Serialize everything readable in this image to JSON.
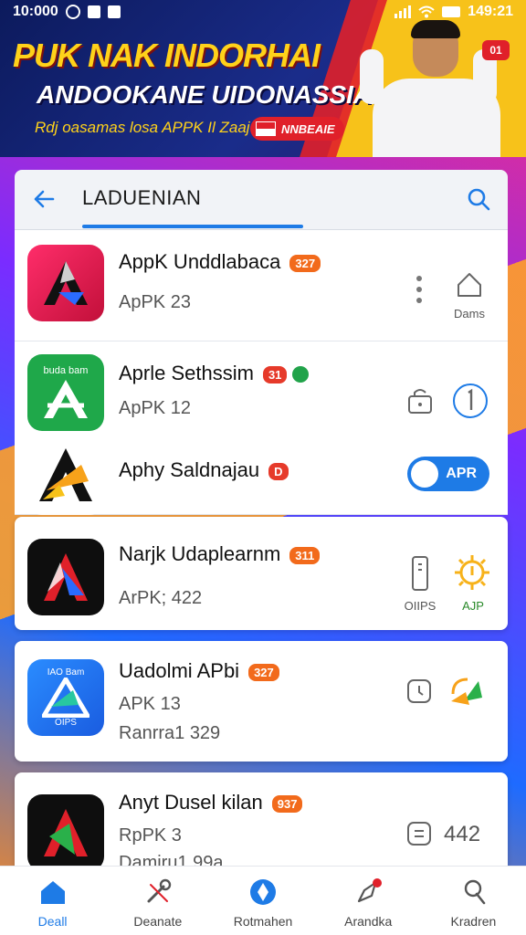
{
  "status_bar": {
    "time": "10:000",
    "right": "149:21"
  },
  "banner": {
    "title": "PUK NAK INDORHAI",
    "subtitle": "ANDOOKANE UIDONASSIAI",
    "tagline": "Rdj oasamas losa APPK Il Zaaj",
    "button": "NNBEAIE",
    "badge": "01"
  },
  "search": {
    "title": "LADUENIAN"
  },
  "apps": [
    {
      "name": "AppK Unddlabaca",
      "badge": "327",
      "meta": "ApPK 23",
      "side_label": "Dams"
    },
    {
      "name": "Aprle Sethssim",
      "badge": "31",
      "meta": "ApPK 12"
    },
    {
      "name": "Aphy Saldnajau",
      "badge": "D",
      "install_label": "APR"
    },
    {
      "name": "Narjk Udaplearnm",
      "badge": "311",
      "meta": "ArPK; 422",
      "side_label_1": "OIIPS",
      "side_label_2": "AJP"
    },
    {
      "name": "Uadolmi APbi",
      "badge": "327",
      "meta": "APK 13",
      "meta2": "Ranrra1 329",
      "icon_text_top": "IAO Bam",
      "icon_text_bottom": "OIPS"
    },
    {
      "name": "Anyt Dusel kilan",
      "badge": "937",
      "meta": "RpPK 3",
      "meta2": "Damiru1 99a",
      "side_value": "442"
    }
  ],
  "app_icon_texts": {
    "green_top": "buda bam"
  },
  "bottom_nav": [
    {
      "label": "Deall",
      "icon": "home-icon",
      "active": true
    },
    {
      "label": "Deanate",
      "icon": "tools-icon",
      "active": false
    },
    {
      "label": "Rotmahen",
      "icon": "globe-icon",
      "active": false
    },
    {
      "label": "Arandka",
      "icon": "rocket-icon",
      "active": false
    },
    {
      "label": "Kradren",
      "icon": "profile-icon",
      "active": false
    }
  ],
  "colors": {
    "accent": "#1e7be6",
    "badge": "#f26a1b",
    "banner_yellow": "#ffd21a"
  }
}
